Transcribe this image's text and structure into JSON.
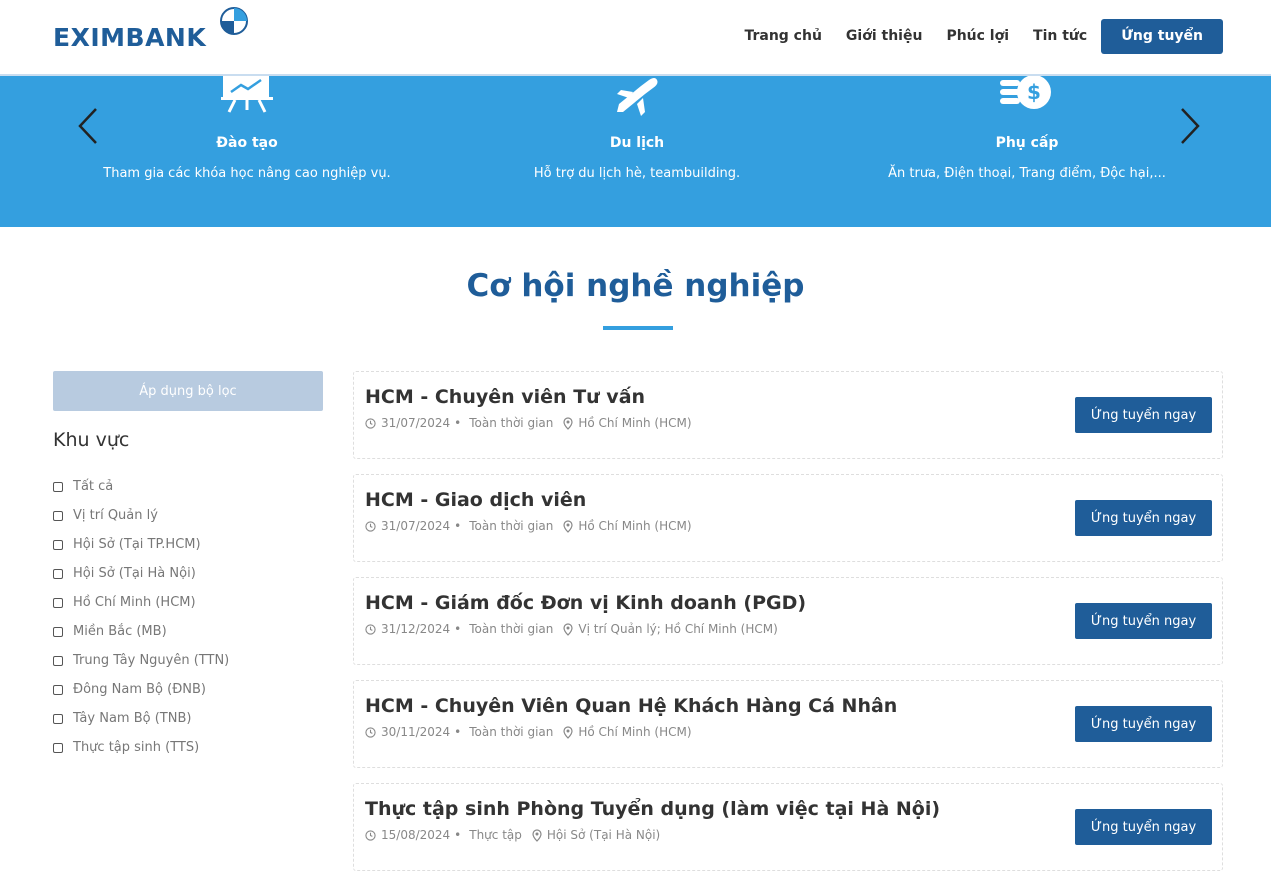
{
  "header": {
    "logo_text": "EXIMBANK",
    "nav": [
      "Trang chủ",
      "Giới thiệu",
      "Phúc lợi",
      "Tin tức"
    ],
    "apply_label": "Ứng tuyển"
  },
  "benefits": [
    {
      "icon": "training-chart-icon",
      "title": "Đào tạo",
      "desc": "Tham gia các khóa học nâng cao nghiệp vụ."
    },
    {
      "icon": "airplane-icon",
      "title": "Du lịch",
      "desc": "Hỗ trợ du lịch hè, teambuilding."
    },
    {
      "icon": "coins-dollar-icon",
      "title": "Phụ cấp",
      "desc": "Ăn trưa, Điện thoại, Trang điểm, Độc hại,..."
    }
  ],
  "section_title": "Cơ hội nghề nghiệp",
  "filter": {
    "apply_label": "Áp dụng bộ lọc",
    "region_title": "Khu vực",
    "regions": [
      "Tất cả",
      "Vị trí Quản lý",
      "Hội Sở (Tại TP.HCM)",
      "Hội Sở (Tại Hà Nội)",
      "Hồ Chí Minh (HCM)",
      "Miền Bắc (MB)",
      "Trung Tây Nguyên (TTN)",
      "Đông Nam Bộ (ĐNB)",
      "Tây Nam Bộ (TNB)",
      "Thực tập sinh (TTS)"
    ]
  },
  "jobs": [
    {
      "title": "HCM - Chuyên viên Tư vấn",
      "date": "31/07/2024",
      "type": "Toàn thời gian",
      "location": "Hồ Chí Minh (HCM)",
      "button": "Ứng tuyển ngay"
    },
    {
      "title": "HCM - Giao dịch viên",
      "date": "31/07/2024",
      "type": "Toàn thời gian",
      "location": "Hồ Chí Minh (HCM)",
      "button": "Ứng tuyển ngay"
    },
    {
      "title": "HCM - Giám đốc Đơn vị Kinh doanh (PGD)",
      "date": "31/12/2024",
      "type": "Toàn thời gian",
      "location": "Vị trí Quản lý; Hồ Chí Minh (HCM)",
      "button": "Ứng tuyển ngay"
    },
    {
      "title": "HCM - Chuyên Viên Quan Hệ Khách Hàng Cá Nhân",
      "date": "30/11/2024",
      "type": "Toàn thời gian",
      "location": "Hồ Chí Minh (HCM)",
      "button": "Ứng tuyển ngay"
    },
    {
      "title": "Thực tập sinh Phòng Tuyển dụng (làm việc tại Hà Nội)",
      "date": "15/08/2024",
      "type": "Thực tập",
      "location": "Hội Sở (Tại Hà Nội)",
      "button": "Ứng tuyển ngay"
    }
  ],
  "colors": {
    "brand": "#1f5d99",
    "banner": "#349fdf"
  }
}
